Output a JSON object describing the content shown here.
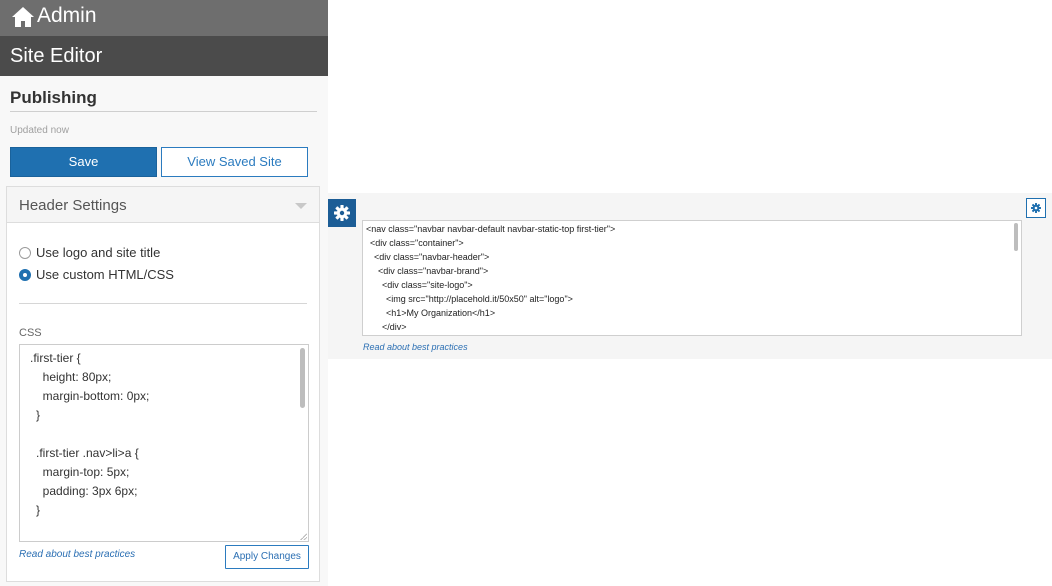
{
  "admin": {
    "title": "Admin",
    "icon": "home-icon"
  },
  "site_editor": {
    "title": "Site Editor"
  },
  "publishing": {
    "heading": "Publishing",
    "status": "Updated now",
    "save_label": "Save",
    "view_label": "View Saved Site"
  },
  "header_settings": {
    "title": "Header Settings",
    "options": [
      {
        "label": "Use logo and site title",
        "checked": false
      },
      {
        "label": "Use custom HTML/CSS",
        "checked": true
      }
    ],
    "css_label": "CSS",
    "css_lines": [
      ".first-tier {",
      "  height: 80px;",
      "  margin-bottom: 0px;",
      "}",
      "",
      ".first-tier .nav>li>a {",
      "  margin-top: 5px;",
      "  padding: 3px 6px;",
      "}"
    ],
    "best_practices_link": "Read about best practices",
    "apply_label": "Apply Changes"
  },
  "html_editor": {
    "lines": [
      "<nav class=\"navbar navbar-default navbar-static-top first-tier\">",
      "<div class=\"container\">",
      "<div class=\"navbar-header\">",
      "<div class=\"navbar-brand\">",
      "<div class=\"site-logo\">",
      "<img src=\"http://placehold.it/50x50\" alt=\"logo\">",
      "<h1>My Organization</h1>",
      "</div>"
    ],
    "best_practices_link": "Read about best practices",
    "gear_icon": "gear-icon"
  },
  "colors": {
    "primary": "#1f70b0",
    "admin_bar": "#6e6e6e",
    "site_editor_bar": "#4b4b4b",
    "gear_badge": "#1c5d96",
    "link": "#2b6fb3"
  }
}
